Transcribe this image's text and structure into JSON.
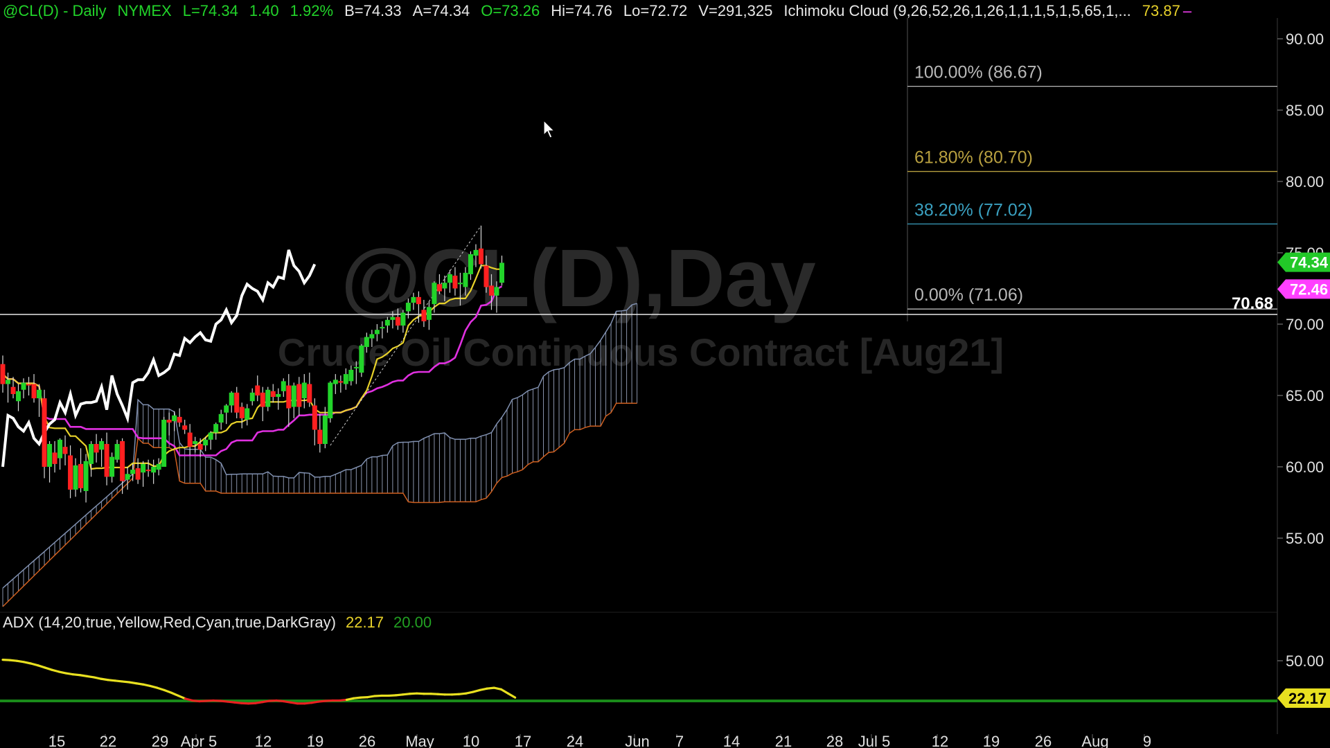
{
  "header": {
    "symbol": "@CL(D) - Daily",
    "exchange": "NYMEX",
    "last": "L=74.34",
    "change": "1.40",
    "change_pct": "1.92%",
    "bid": "B=74.33",
    "ask": "A=74.34",
    "open": "O=73.26",
    "high": "Hi=74.76",
    "low": "Lo=72.72",
    "volume": "V=291,325",
    "study": "Ichimoku Cloud (9,26,52,26,1,26,1,1,1,5,1,5,65,1,...",
    "study_value": "73.87",
    "study_dash": "–"
  },
  "watermark": {
    "line1": "@CL(D),Day",
    "line2": "Crude Oil Continuous Contract [Aug21]"
  },
  "price_axis": {
    "ticks": [
      {
        "label": "90.00",
        "value": 90
      },
      {
        "label": "85.00",
        "value": 85
      },
      {
        "label": "80.00",
        "value": 80
      },
      {
        "label": "75.00",
        "value": 75
      },
      {
        "label": "70.00",
        "value": 70
      },
      {
        "label": "65.00",
        "value": 65
      },
      {
        "label": "60.00",
        "value": 60
      },
      {
        "label": "55.00",
        "value": 55
      }
    ],
    "badges": [
      {
        "label": "74.34",
        "value": 74.34,
        "color": "#22c828",
        "text_color": "#ffffff"
      },
      {
        "label": "72.46",
        "value": 72.46,
        "color": "#ff40ff",
        "text_color": "#ffffff"
      }
    ]
  },
  "horizontal_line": {
    "label": "70.68",
    "value": 70.68
  },
  "fibonacci": [
    {
      "label": "100.00% (86.67)",
      "value": 86.67,
      "color": "#b8b8b8"
    },
    {
      "label": "61.80% (80.70)",
      "value": 80.7,
      "color": "#b8a040"
    },
    {
      "label": "38.20% (77.02)",
      "value": 77.02,
      "color": "#3aa0c0"
    },
    {
      "label": "0.00% (71.06)",
      "value": 71.06,
      "color": "#b8b8b8"
    }
  ],
  "x_axis": {
    "ticks": [
      "15",
      "22",
      "29",
      "Apr 5",
      "12",
      "19",
      "26",
      "May",
      "10",
      "17",
      "24",
      "Jun",
      "7",
      "14",
      "21",
      "28",
      "Jul 5",
      "12",
      "19",
      "26",
      "Aug",
      "9"
    ]
  },
  "adx": {
    "label": "ADX (14,20,true,Yellow,Red,Cyan,true,DarkGray)",
    "value": "22.17",
    "threshold": "20.00",
    "axis_tick": "50.00",
    "badge": "22.17",
    "colors": {
      "above": "#e8e020",
      "below": "#e82020",
      "threshold_line": "#1a8a1a"
    }
  },
  "colors": {
    "background": "#000000",
    "up_candle": "#22d42a",
    "down_candle": "#ff2020",
    "tenkan": "#e8d22a",
    "kijun": "#e030e0",
    "chikou": "#ffffff",
    "span_a": "#8090b0",
    "span_b": "#d06020",
    "cloud_hatch": "#8a94ac"
  },
  "chart_data": {
    "type": "candlestick",
    "title": "@CL(D) - Daily",
    "ylim": [
      50,
      92
    ],
    "series": [
      {
        "name": "price",
        "type": "ohlc",
        "candles": [
          [
            67.2,
            67.8,
            65.2,
            65.8
          ],
          [
            65.8,
            66.6,
            64.5,
            66.1
          ],
          [
            65.6,
            66.3,
            64.8,
            65.1
          ],
          [
            64.6,
            65.8,
            63.9,
            65.3
          ],
          [
            65.4,
            66.2,
            64.8,
            65.9
          ],
          [
            65.8,
            66.3,
            65.0,
            65.7
          ],
          [
            65.8,
            66.5,
            64.5,
            64.8
          ],
          [
            64.8,
            65.8,
            63.5,
            65.4
          ],
          [
            64.8,
            65.4,
            59.2,
            60.0
          ],
          [
            60.0,
            61.8,
            58.9,
            61.6
          ],
          [
            61.0,
            61.8,
            59.6,
            60.2
          ],
          [
            60.6,
            62.0,
            59.8,
            61.9
          ],
          [
            61.4,
            62.2,
            60.1,
            60.9
          ],
          [
            60.8,
            61.5,
            57.8,
            58.4
          ],
          [
            58.4,
            60.6,
            57.9,
            60.1
          ],
          [
            60.2,
            61.3,
            58.2,
            58.5
          ],
          [
            58.3,
            60.9,
            57.5,
            60.4
          ],
          [
            60.2,
            61.8,
            59.3,
            61.6
          ],
          [
            61.6,
            62.3,
            60.3,
            61.0
          ],
          [
            61.2,
            62.0,
            60.0,
            61.8
          ],
          [
            61.6,
            62.4,
            58.7,
            59.3
          ],
          [
            59.3,
            61.0,
            58.9,
            60.7
          ],
          [
            60.5,
            61.9,
            60.3,
            61.6
          ],
          [
            61.8,
            62.0,
            58.1,
            59.0
          ],
          [
            59.1,
            60.0,
            58.4,
            59.5
          ],
          [
            59.5,
            60.2,
            59.0,
            59.8
          ],
          [
            59.9,
            60.6,
            58.8,
            59.1
          ],
          [
            59.6,
            60.4,
            58.6,
            60.2
          ],
          [
            59.8,
            60.5,
            59.3,
            59.7
          ],
          [
            59.6,
            60.5,
            58.8,
            60.0
          ],
          [
            59.8,
            60.6,
            59.4,
            60.2
          ],
          [
            60.0,
            63.5,
            60.0,
            63.3
          ],
          [
            63.3,
            63.8,
            62.2,
            63.1
          ],
          [
            63.2,
            63.9,
            62.5,
            63.6
          ],
          [
            63.5,
            64.1,
            62.8,
            63.1
          ],
          [
            62.9,
            63.3,
            62.3,
            62.6
          ],
          [
            62.4,
            63.0,
            60.8,
            61.4
          ],
          [
            61.6,
            62.1,
            61.0,
            61.8
          ],
          [
            61.6,
            62.0,
            60.7,
            61.2
          ],
          [
            61.5,
            62.1,
            61.1,
            61.9
          ],
          [
            61.9,
            62.5,
            61.2,
            62.4
          ],
          [
            62.4,
            63.1,
            61.9,
            63.0
          ],
          [
            63.1,
            64.0,
            62.6,
            63.7
          ],
          [
            63.8,
            64.4,
            63.0,
            64.3
          ],
          [
            64.3,
            65.3,
            63.8,
            65.2
          ],
          [
            65.2,
            65.6,
            63.4,
            63.8
          ],
          [
            64.2,
            64.5,
            62.7,
            63.4
          ],
          [
            63.3,
            64.4,
            62.9,
            64.1
          ],
          [
            64.6,
            65.5,
            64.3,
            65.2
          ],
          [
            65.7,
            66.4,
            64.6,
            65.0
          ],
          [
            65.2,
            65.6,
            63.2,
            64.2
          ],
          [
            64.2,
            65.6,
            63.9,
            65.4
          ],
          [
            65.3,
            65.8,
            64.5,
            64.9
          ],
          [
            64.9,
            65.5,
            64.0,
            65.1
          ],
          [
            65.3,
            66.2,
            64.9,
            66.0
          ],
          [
            65.7,
            66.5,
            62.8,
            64.1
          ],
          [
            64.2,
            65.9,
            63.4,
            65.7
          ],
          [
            65.8,
            66.3,
            63.6,
            64.2
          ],
          [
            64.8,
            66.5,
            64.1,
            65.9
          ],
          [
            65.8,
            66.6,
            64.2,
            64.5
          ],
          [
            64.3,
            64.8,
            61.5,
            62.6
          ],
          [
            62.6,
            63.7,
            61.0,
            61.6
          ],
          [
            61.6,
            64.2,
            61.3,
            63.6
          ],
          [
            63.4,
            66.0,
            63.1,
            65.9
          ],
          [
            65.8,
            66.5,
            65.1,
            66.1
          ],
          [
            66.0,
            66.4,
            65.2,
            65.9
          ],
          [
            65.8,
            66.9,
            65.4,
            66.5
          ],
          [
            66.0,
            67.1,
            65.7,
            66.8
          ],
          [
            66.9,
            67.4,
            65.8,
            67.0
          ],
          [
            66.6,
            68.6,
            66.3,
            68.5
          ],
          [
            68.4,
            69.4,
            68.0,
            69.1
          ],
          [
            69.0,
            69.6,
            68.4,
            69.3
          ],
          [
            69.3,
            70.0,
            68.8,
            69.6
          ],
          [
            69.7,
            70.2,
            69.0,
            69.8
          ],
          [
            69.9,
            70.5,
            69.4,
            70.3
          ],
          [
            70.3,
            70.9,
            69.7,
            70.5
          ],
          [
            70.5,
            71.1,
            69.6,
            69.9
          ],
          [
            69.9,
            71.0,
            69.4,
            70.8
          ],
          [
            70.9,
            71.8,
            70.4,
            71.5
          ],
          [
            71.5,
            72.2,
            71.0,
            71.9
          ],
          [
            71.9,
            72.3,
            70.1,
            71.4
          ],
          [
            71.0,
            71.7,
            69.8,
            70.2
          ],
          [
            70.3,
            71.6,
            69.6,
            71.2
          ],
          [
            71.4,
            73.0,
            70.8,
            72.9
          ],
          [
            72.8,
            73.5,
            72.1,
            72.3
          ],
          [
            72.5,
            73.4,
            71.6,
            72.9
          ],
          [
            72.9,
            73.8,
            72.2,
            73.5
          ],
          [
            73.4,
            74.0,
            72.0,
            72.5
          ],
          [
            72.8,
            73.6,
            71.3,
            72.9
          ],
          [
            72.6,
            74.0,
            72.0,
            73.6
          ],
          [
            73.5,
            75.1,
            73.1,
            74.9
          ],
          [
            74.8,
            75.6,
            74.0,
            75.2
          ],
          [
            75.3,
            76.9,
            73.9,
            74.2
          ],
          [
            74.1,
            74.8,
            72.2,
            72.6
          ],
          [
            72.7,
            73.5,
            71.0,
            72.0
          ],
          [
            72.0,
            73.0,
            70.8,
            72.6
          ],
          [
            72.9,
            74.8,
            72.7,
            74.3
          ]
        ]
      },
      {
        "name": "tenkan",
        "values": "derived"
      },
      {
        "name": "kijun",
        "values": "derived"
      },
      {
        "name": "chikou",
        "values": [
          60.0,
          63.6,
          63.4,
          62.8,
          62.5,
          63.1,
          62.0,
          61.6,
          62.4,
          63.0,
          63.3,
          64.5,
          63.8,
          65.1,
          63.6,
          64.4,
          64.5,
          64.5,
          64.6,
          65.6,
          64.0,
          66.4,
          65.1,
          64.3,
          63.4,
          65.9,
          66.1,
          66.1,
          66.6,
          67.5,
          66.4,
          66.6,
          66.9,
          67.9,
          67.8,
          69.0,
          68.7,
          69.1,
          69.4,
          68.9,
          68.8,
          70.0,
          70.3,
          71.0,
          70.1,
          70.6,
          72.0,
          72.8,
          72.5,
          72.3,
          71.7,
          72.9,
          72.6,
          73.3,
          73.2,
          75.2,
          74.1,
          73.7,
          72.9,
          73.4,
          74.2
        ]
      },
      {
        "name": "senkou_span_a",
        "values": "derived"
      },
      {
        "name": "senkou_span_b",
        "values": "derived"
      }
    ],
    "adx_values": [
      50.5,
      50.4,
      50.2,
      49.9,
      49.5,
      49.0,
      48.4,
      47.8,
      47.3,
      46.9,
      46.6,
      46.4,
      46.1,
      45.8,
      45.4,
      45.1,
      44.9,
      44.7,
      44.5,
      44.2,
      43.9,
      43.5,
      43.0,
      42.4,
      41.7,
      40.9,
      40.1,
      39.6,
      39.4,
      39.5,
      39.6,
      39.5,
      39.3,
      39.1,
      38.9,
      38.8,
      38.9,
      39.2,
      39.5,
      39.6,
      39.4,
      39.1,
      38.8,
      38.8,
      39.0,
      39.3,
      39.5,
      39.6,
      39.6,
      39.8,
      40.2,
      40.4,
      40.5,
      40.8,
      40.9,
      40.9,
      41.0,
      41.2,
      41.4,
      41.5,
      41.4,
      41.4,
      41.3,
      41.2,
      41.2,
      41.3,
      41.5,
      41.9,
      42.4,
      42.8,
      43.0,
      42.6,
      41.5,
      40.4
    ]
  }
}
